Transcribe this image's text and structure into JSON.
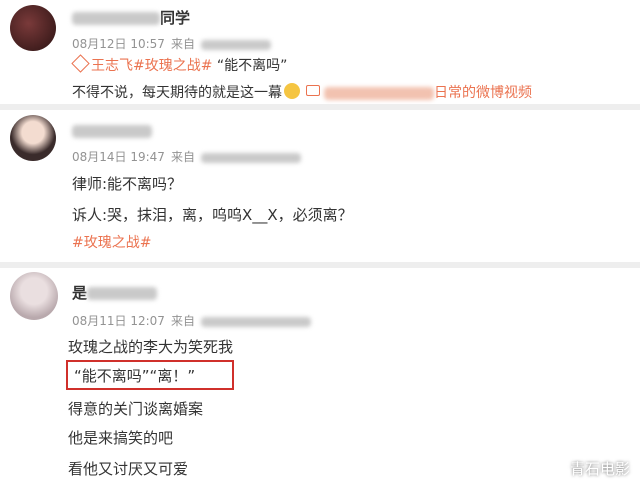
{
  "posts": [
    {
      "name_visible": "同学",
      "date": "08月12日 10:57",
      "source_prefix": "来自",
      "topic_line": "#王志飞#玫瑰之战# “能不离吗”",
      "topic_actor": "王志飞",
      "topic_show": "#玫瑰之战#",
      "topic_quote": "“能不离吗”",
      "body_text": "不得不说，每天期待的就是这一幕",
      "link_suffix": "日常的微博视频"
    },
    {
      "date": "08月14日 19:47",
      "source_prefix": "来自",
      "lines": [
        "律师:能不离吗？",
        "诉人:哭，抹泪，离，呜呜X__X，必须离？"
      ],
      "hashtag": "#玫瑰之战#"
    },
    {
      "name_visible": "是",
      "date": "08月11日 12:07",
      "source_prefix": "来自",
      "lines": [
        "玫瑰之战的李大为笑死我",
        "“能不离吗”“离！”",
        "得意的关门谈离婚案",
        "他是来搞笑的吧",
        "看他又讨厌又可爱"
      ]
    }
  ],
  "watermark": "青石电影",
  "colors": {
    "tag": "#eb7350",
    "highlight_border": "#d0302b",
    "meta": "#939393"
  }
}
